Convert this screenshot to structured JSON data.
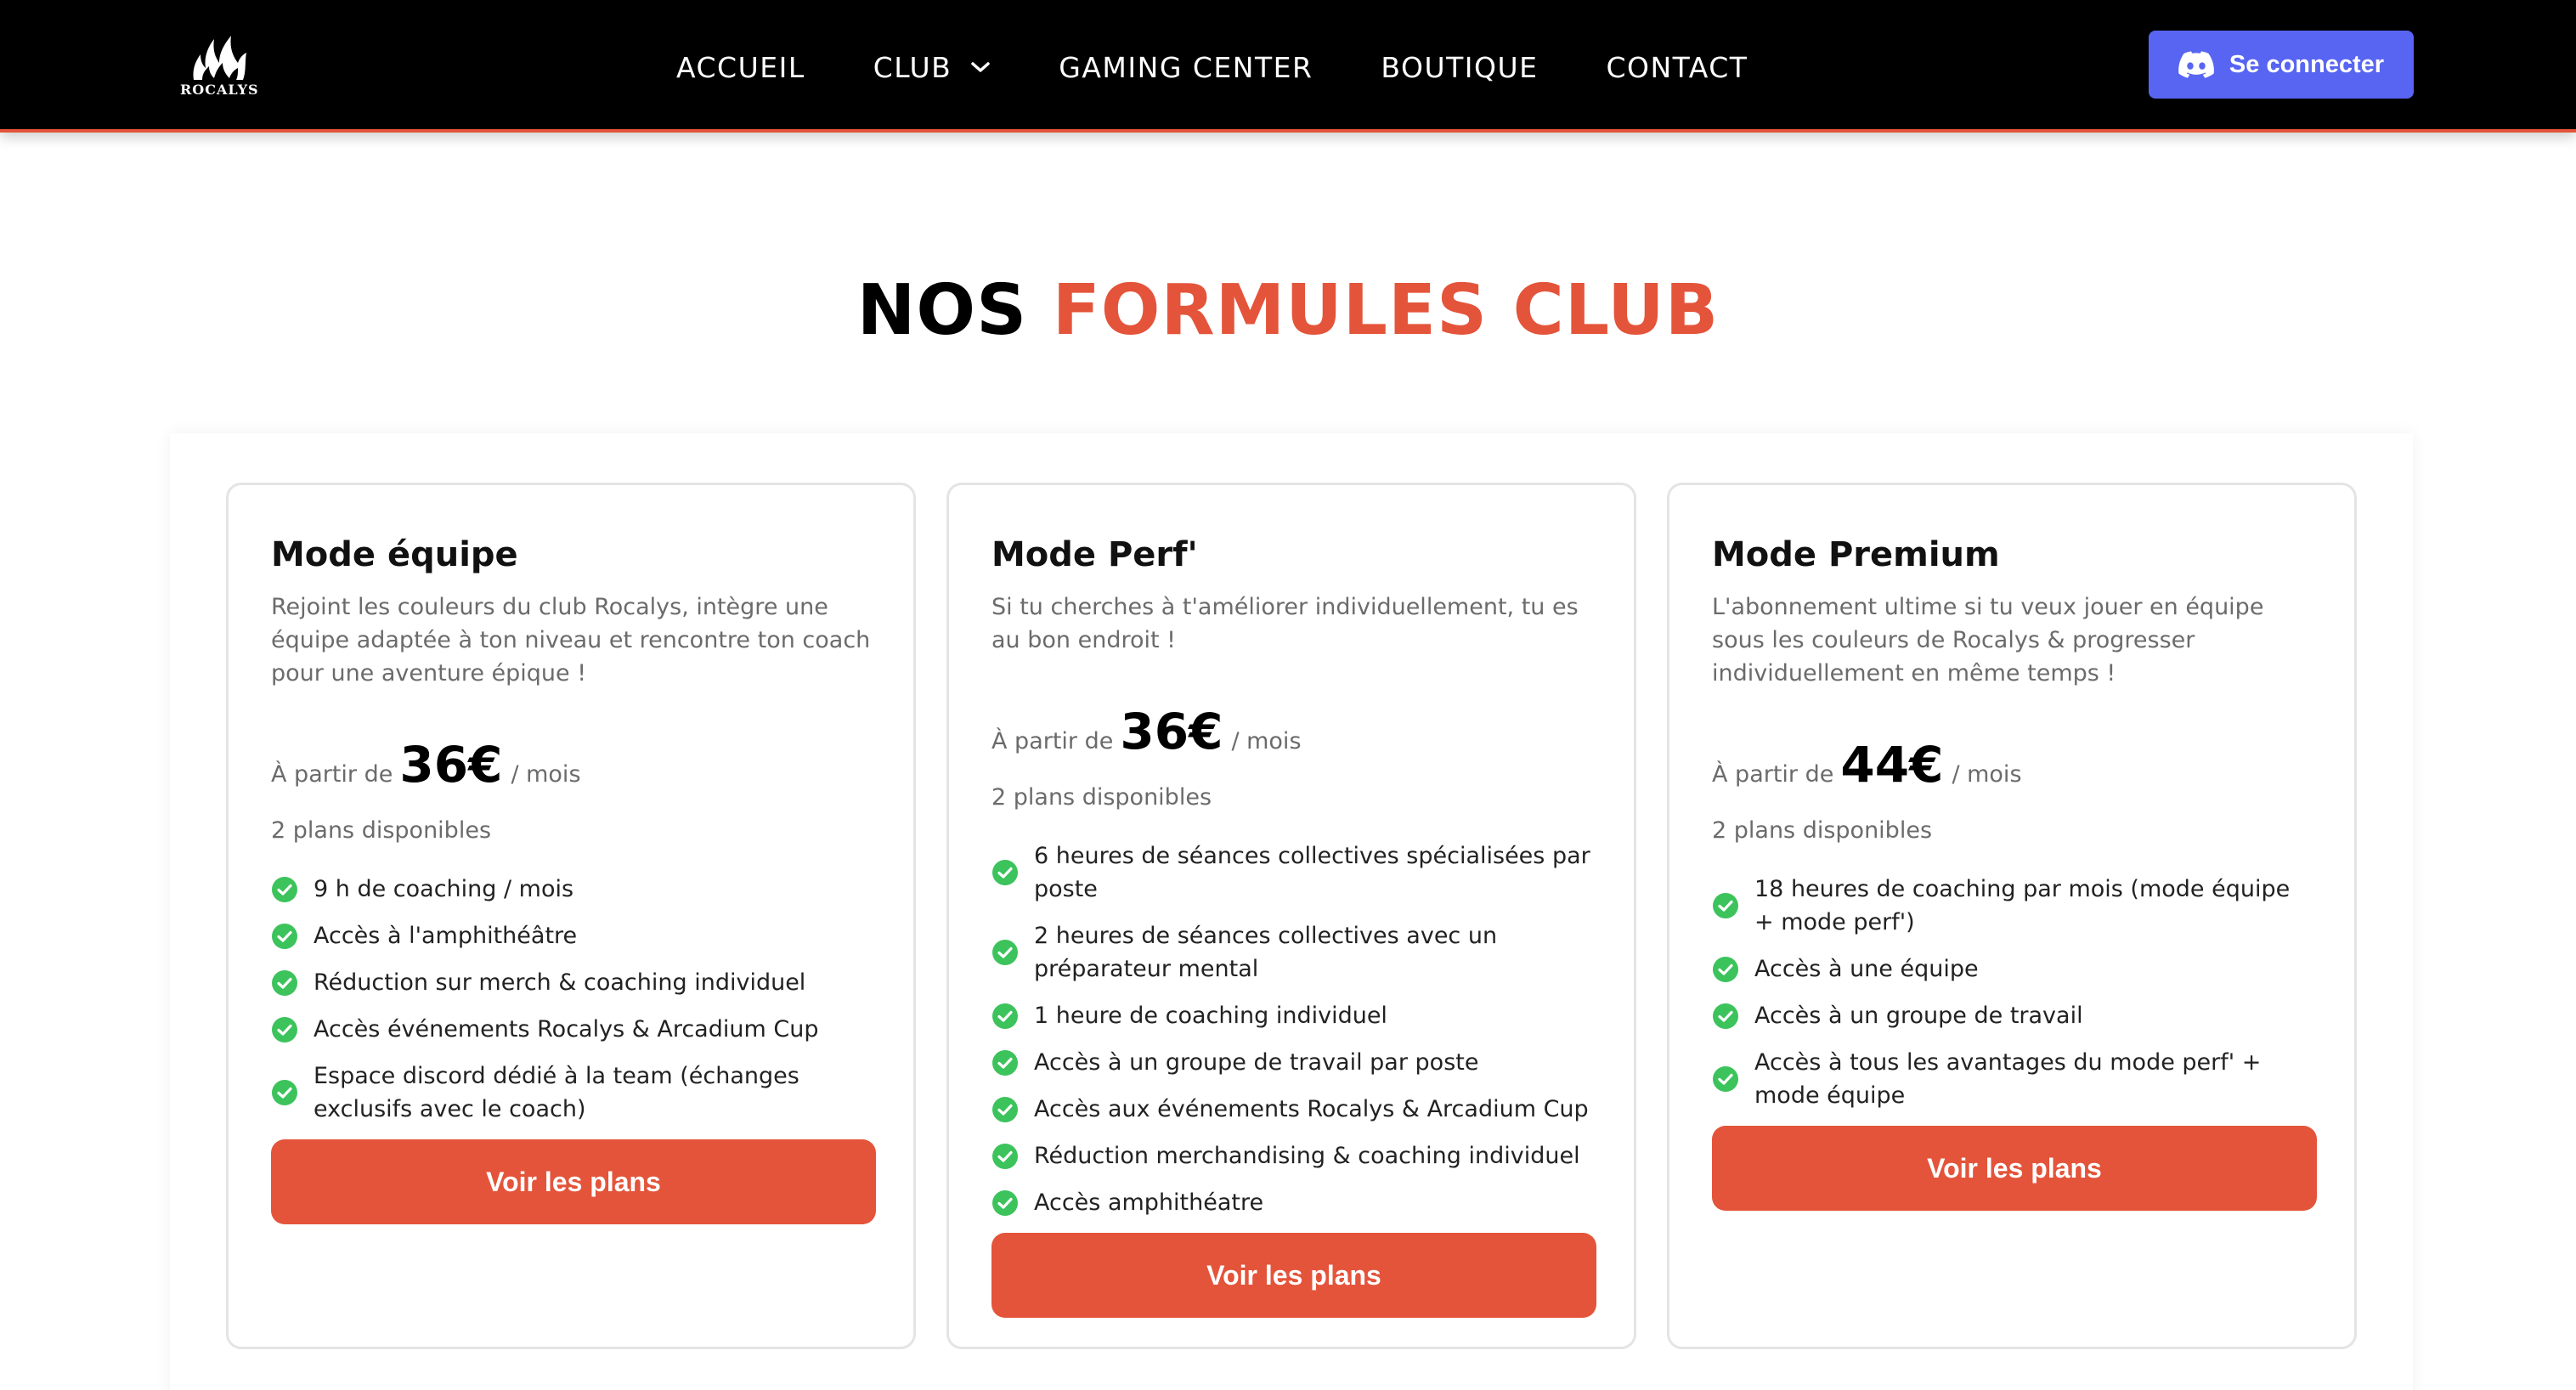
{
  "nav": {
    "logo_text": "ROCALYS",
    "links": [
      "ACCUEIL",
      "CLUB",
      "GAMING CENTER",
      "BOUTIQUE",
      "CONTACT"
    ],
    "login_label": "Se connecter"
  },
  "heading": {
    "part1": "NOS ",
    "part2": "FORMULES CLUB"
  },
  "cards": [
    {
      "title": "Mode équipe",
      "description": "Rejoint les couleurs du club Rocalys, intègre une équipe adaptée à ton niveau et rencontre ton coach pour une aventure épique !",
      "price_prefix": "À partir de",
      "price": "36€",
      "price_suffix": "/ mois",
      "plans": "2 plans disponibles",
      "features": [
        "9 h de coaching / mois",
        "Accès à l'amphithéâtre",
        "Réduction sur merch & coaching individuel",
        "Accès événements Rocalys & Arcadium Cup",
        "Espace discord dédié à la team (échanges exclusifs avec le coach)"
      ],
      "cta": "Voir les plans"
    },
    {
      "title": "Mode Perf'",
      "description": "Si tu cherches à t'améliorer individuellement, tu es au bon endroit !",
      "price_prefix": "À partir de",
      "price": "36€",
      "price_suffix": "/ mois",
      "plans": "2 plans disponibles",
      "features": [
        "6 heures de séances collectives spécialisées par poste",
        "2 heures de séances collectives avec un préparateur mental",
        "1 heure de coaching individuel",
        "Accès à un groupe de travail par poste",
        "Accès aux événements Rocalys & Arcadium Cup",
        "Réduction merchandising & coaching individuel",
        "Accès amphithéatre"
      ],
      "cta": "Voir les plans"
    },
    {
      "title": "Mode Premium",
      "description": "L'abonnement ultime si tu veux jouer en équipe sous les couleurs de Rocalys & progresser individuellement en même temps !",
      "price_prefix": "À partir de",
      "price": "44€",
      "price_suffix": "/ mois",
      "plans": "2 plans disponibles",
      "features": [
        "18 heures de coaching par mois (mode équipe + mode perf')",
        "Accès à une équipe",
        "Accès à un groupe de travail",
        "Accès à tous les avantages du mode perf' + mode équipe"
      ],
      "cta": "Voir les plans"
    }
  ],
  "colors": {
    "accent": "#e4543a",
    "discord": "#5865f2",
    "check": "#3cc35c",
    "nav_bg": "#000000"
  },
  "icons": {
    "logo": "flame-logo-icon",
    "dropdown": "chevron-down-icon",
    "login": "discord-icon",
    "feature": "check-circle-icon"
  }
}
